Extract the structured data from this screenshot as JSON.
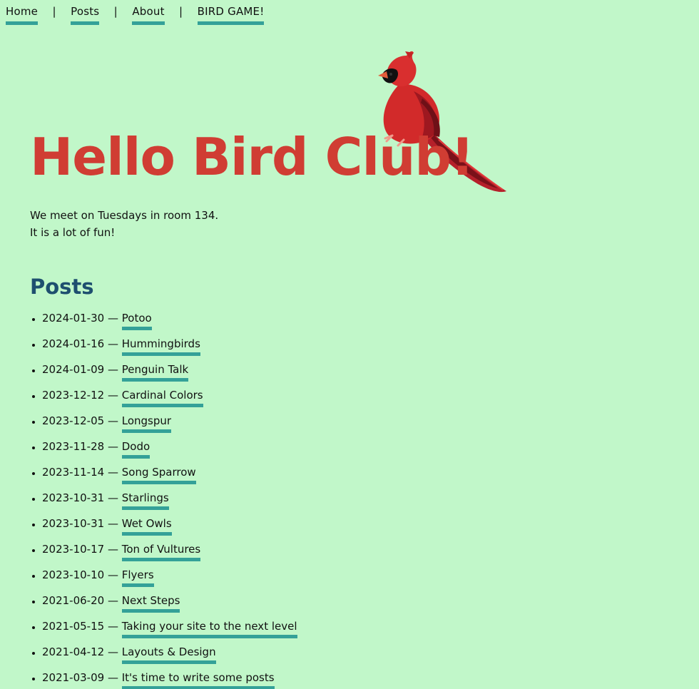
{
  "nav": {
    "items": [
      {
        "label": "Home"
      },
      {
        "label": "Posts"
      },
      {
        "label": "About"
      },
      {
        "label": "BIRD GAME!"
      }
    ],
    "separator": "|"
  },
  "hero": {
    "title": "Hello Bird Club!",
    "image_icon": "cardinal-bird"
  },
  "intro": {
    "line1": "We meet on Tuesdays in room 134.",
    "line2": "It is a lot of fun!"
  },
  "posts": {
    "heading": "Posts",
    "separator": "—",
    "items": [
      {
        "date": "2024-01-30",
        "title": "Potoo"
      },
      {
        "date": "2024-01-16",
        "title": "Hummingbirds"
      },
      {
        "date": "2024-01-09",
        "title": "Penguin Talk"
      },
      {
        "date": "2023-12-12",
        "title": "Cardinal Colors"
      },
      {
        "date": "2023-12-05",
        "title": "Longspur"
      },
      {
        "date": "2023-11-28",
        "title": "Dodo"
      },
      {
        "date": "2023-11-14",
        "title": "Song Sparrow"
      },
      {
        "date": "2023-10-31",
        "title": "Starlings"
      },
      {
        "date": "2023-10-31",
        "title": "Wet Owls"
      },
      {
        "date": "2023-10-17",
        "title": "Ton of Vultures"
      },
      {
        "date": "2023-10-10",
        "title": "Flyers"
      },
      {
        "date": "2021-06-20",
        "title": "Next Steps"
      },
      {
        "date": "2021-05-15",
        "title": "Taking your site to the next level"
      },
      {
        "date": "2021-04-12",
        "title": "Layouts & Design"
      },
      {
        "date": "2021-03-09",
        "title": "It's time to write some posts"
      }
    ]
  },
  "colors": {
    "background": "#c1f7c9",
    "title": "#d03d33",
    "heading": "#1e4f6f",
    "link_underline": "#34a198"
  }
}
